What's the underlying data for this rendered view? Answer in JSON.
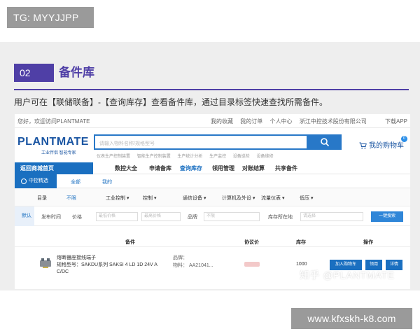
{
  "badges": {
    "top": "TG: MYYJJPP",
    "bottom": "www.kfxskh-k8.com"
  },
  "section": {
    "number": "02",
    "title": "备件库",
    "description": "用户可在【联储联备】-【查询库存】查看备件库，通过目录标签快速查找所需备件。"
  },
  "site": {
    "topbar": {
      "welcome": "您好，欢迎访问PLANTMATE",
      "links": [
        "我的收藏",
        "我的订单",
        "个人中心",
        "浙江中控技术股份有限公司"
      ],
      "app": "下载APP"
    },
    "logo": {
      "name": "PLANTMATE",
      "slogan": "工业伴侣 智能专家"
    },
    "search": {
      "placeholder": "请输入物料名称/规格型号",
      "hot": [
        "仪表生产控制装置",
        "智能生产控制装置",
        "生产统计分析",
        "生产监控",
        "设备巡检",
        "设备维修"
      ]
    },
    "cart": {
      "label": "我的购物车",
      "count": "0"
    },
    "nav": {
      "home": "返回商城首页",
      "items": [
        "数控大全",
        "申请备库",
        "查询库存",
        "领用管理",
        "对账结算",
        "共享备件"
      ],
      "active_index": 2
    },
    "tabs": {
      "main": "中控精选",
      "others": [
        "全部",
        "我的"
      ]
    },
    "categories": {
      "label": "目录",
      "first": "不限",
      "items": [
        "工业控制 ▾",
        "控制 ▾",
        "通信设备 ▾",
        "计算机及外设 ▾",
        "流量仪表 ▾",
        "低压 ▾"
      ]
    },
    "filter": {
      "default": "默认",
      "release_time": "发布时间",
      "price": "价格",
      "price_min": "最低价格",
      "price_max": "最高价格",
      "brand_label": "品牌",
      "brand_ph": "不限",
      "stock_label": "库存所在地",
      "stock_ph": "请选择",
      "button": "一键搜索"
    },
    "table": {
      "headers": [
        "备件",
        "协议价",
        "库存",
        "操作"
      ],
      "rows": [
        {
          "name": "熔断器座接线端子",
          "model": "规格型号：SAKDU系列 SAKSI 4 LD 1D 24V A C/DC",
          "brand": "品牌：",
          "code": "物料：  AA21041...",
          "stock": "1000",
          "actions": [
            "加入购物车",
            "领用",
            "详情"
          ]
        }
      ]
    }
  },
  "watermark": "知乎 @PLANTMATE",
  "colors": {
    "accent": "#4f3fa6",
    "brand_blue": "#1a6fc0",
    "badge_gray": "#9a9a9a",
    "panel_bg": "#eeeeee"
  }
}
